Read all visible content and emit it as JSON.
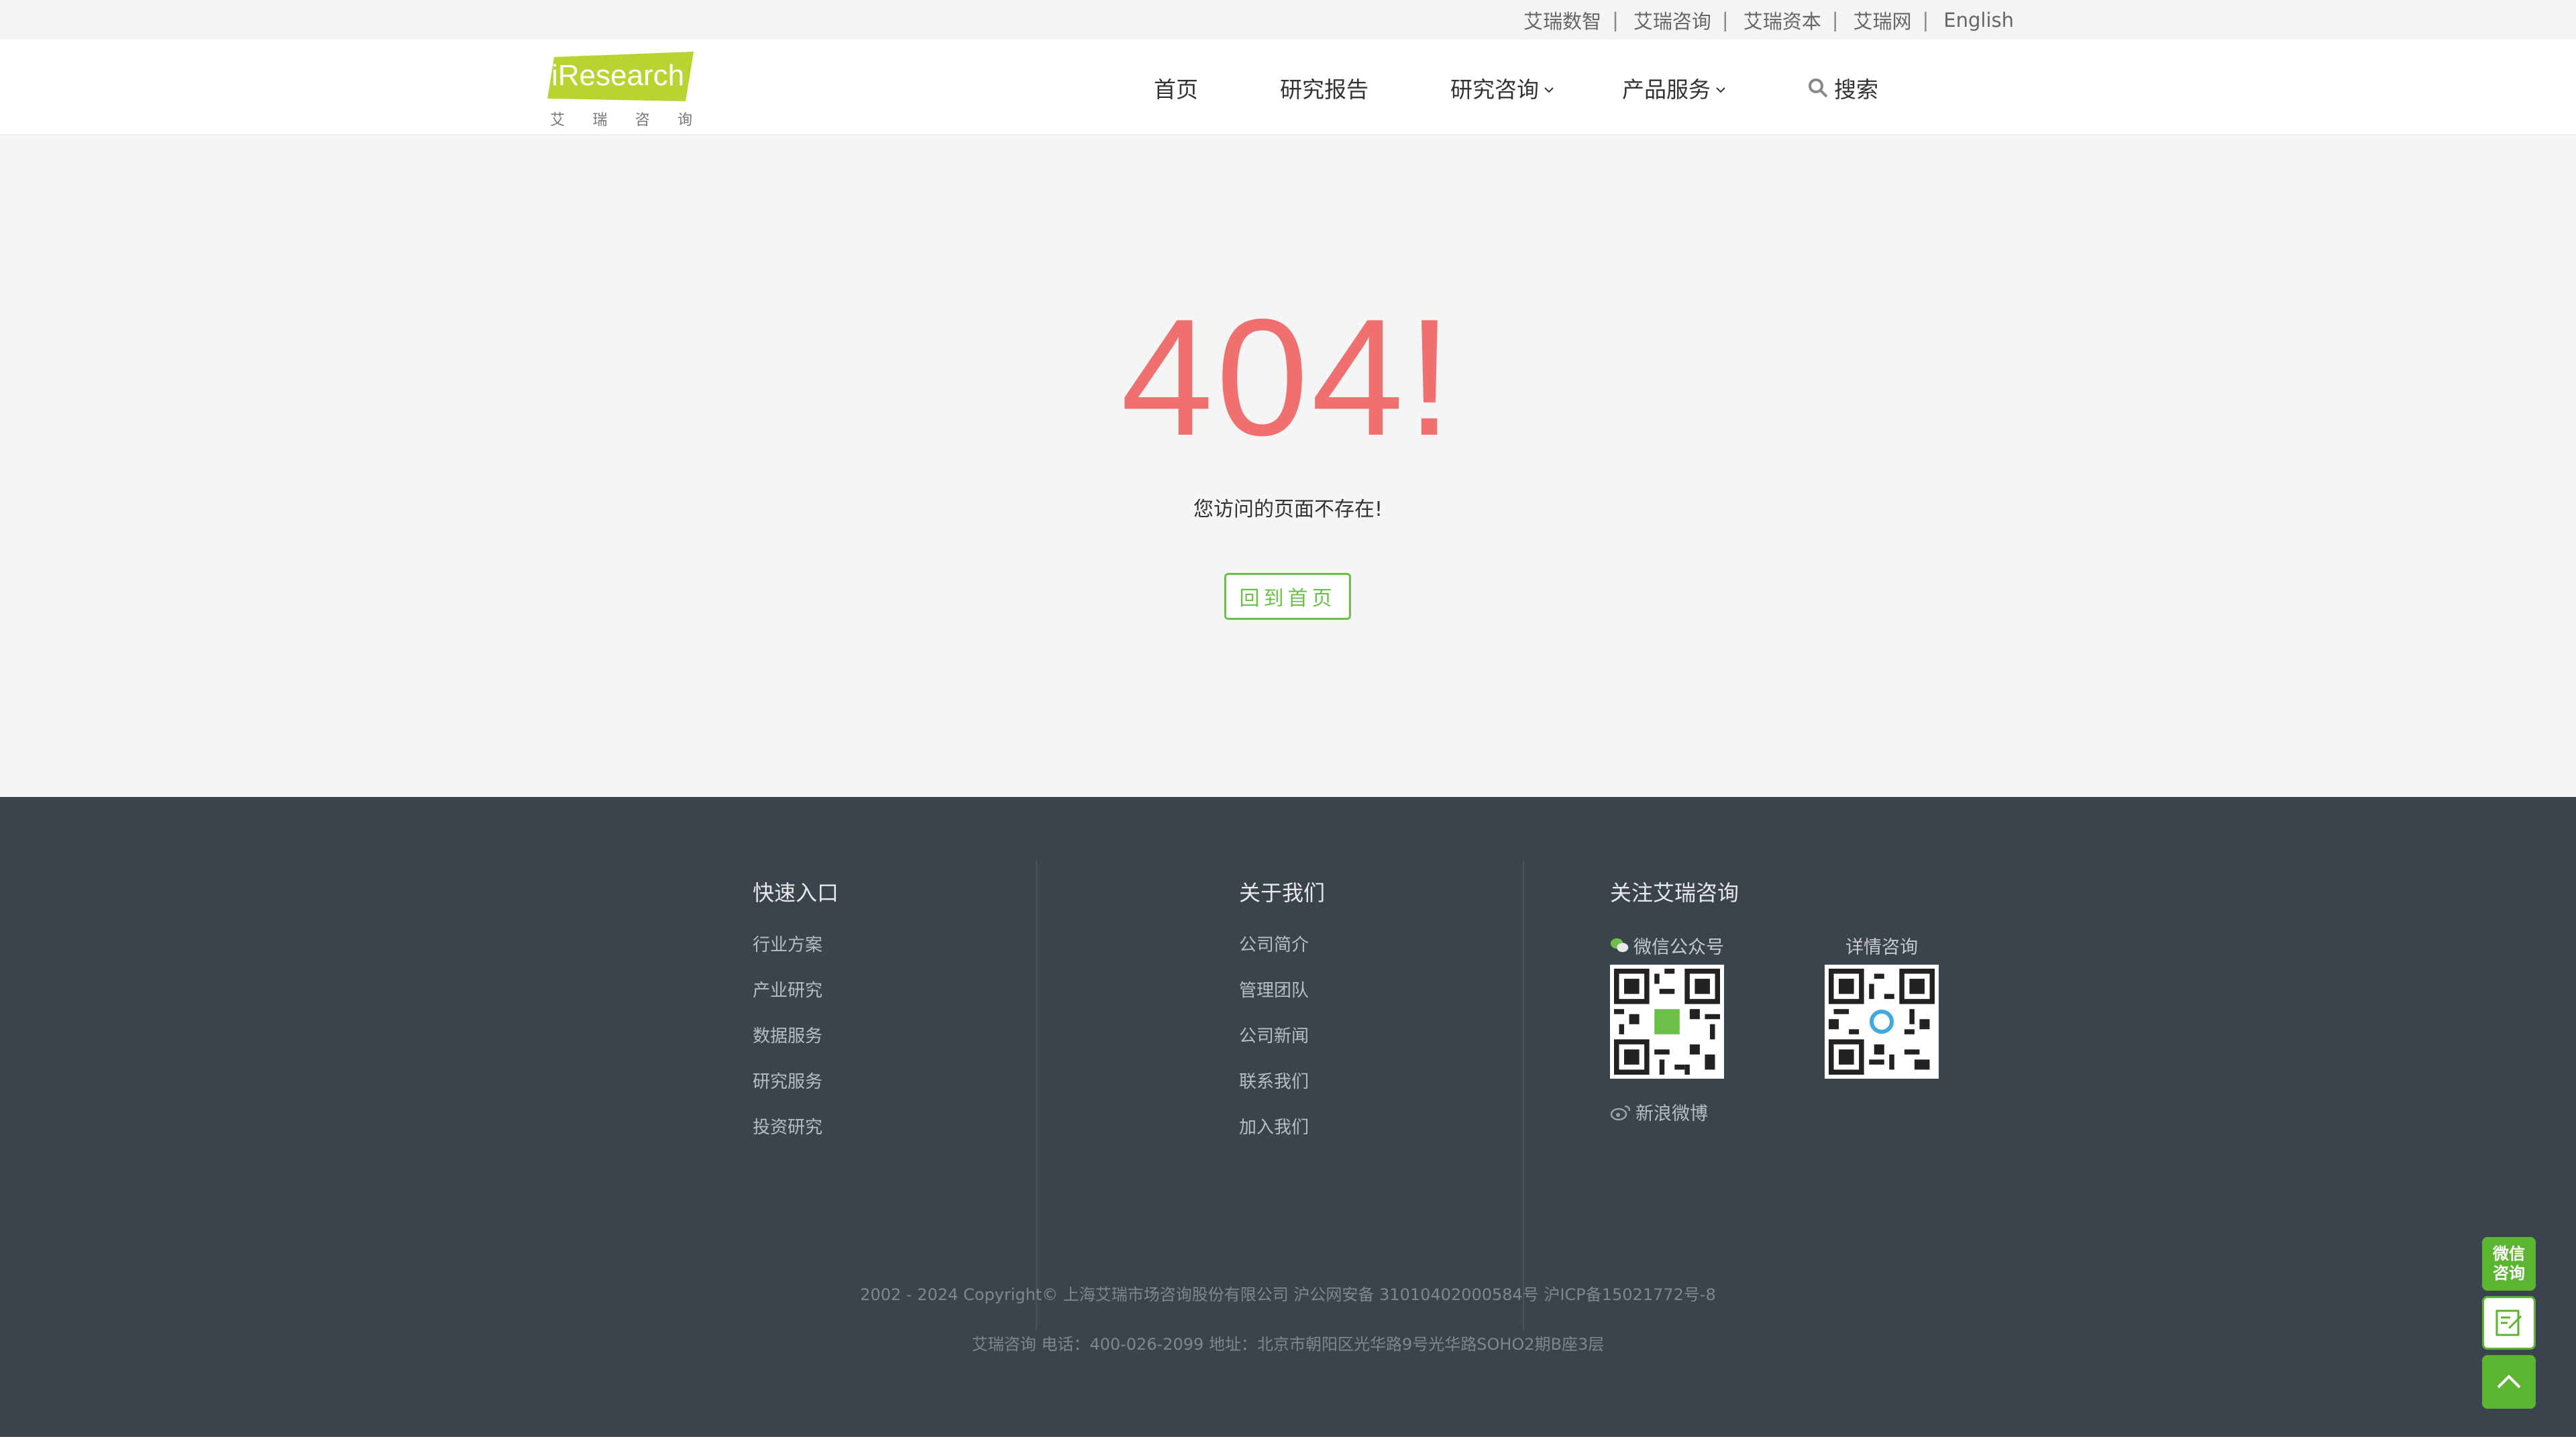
{
  "topbar": {
    "links": [
      "艾瑞数智",
      "艾瑞咨询",
      "艾瑞资本",
      "艾瑞网",
      "English"
    ],
    "separator": "|"
  },
  "header": {
    "logo_text": "iResearch",
    "logo_sub": [
      "艾",
      "瑞",
      "咨",
      "询"
    ],
    "nav": {
      "home": "首页",
      "reports": "研究报告",
      "consulting": "研究咨询",
      "products": "产品服务",
      "search": "搜索"
    }
  },
  "main": {
    "error_code": "404!",
    "message": "您访问的页面不存在!",
    "back_button": "回到首页"
  },
  "footer": {
    "quick": {
      "title": "快速入口",
      "items": [
        "行业方案",
        "产业研究",
        "数据服务",
        "研究服务",
        "投资研究"
      ]
    },
    "about": {
      "title": "关于我们",
      "items": [
        "公司简介",
        "管理团队",
        "公司新闻",
        "联系我们",
        "加入我们"
      ]
    },
    "follow": {
      "title": "关注艾瑞咨询",
      "wechat_label": "微信公众号",
      "detail_label": "详情咨询",
      "weibo_label": "新浪微博"
    },
    "copyright": "2002 - 2024 Copyright© 上海艾瑞市场咨询股份有限公司 沪公网安备 31010402000584号 沪ICP备15021772号-8",
    "address": "艾瑞咨询 电话：400-026-2099 地址：北京市朝阳区光华路9号光华路SOHO2期B座3层"
  },
  "floating": {
    "wechat_line1": "微信",
    "wechat_line2": "咨询"
  },
  "colors": {
    "accent_green": "#6cc04a",
    "error_red": "#f07070",
    "footer_bg": "#3b434d",
    "logo_green": "#b7d431"
  }
}
